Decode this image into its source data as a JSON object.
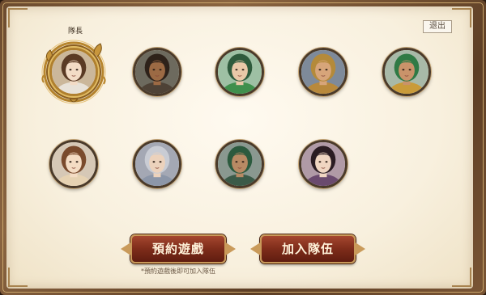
{
  "dialog": {
    "exit_label": "退出",
    "leader_label": "隊長"
  },
  "members": [
    {
      "id": "leader",
      "is_leader": true,
      "portrait": "female-long-brown-hair",
      "palette": {
        "skin": "#f3dcc6",
        "hair": "#5a3a24",
        "bg": "#cbb79a",
        "armor": "#e8e2d8"
      }
    },
    {
      "id": "member-2",
      "is_leader": false,
      "portrait": "bearded-warrior-dark",
      "palette": {
        "skin": "#9c6a44",
        "hair": "#2e221a",
        "bg": "#6d6a5e",
        "armor": "#4e4236"
      }
    },
    {
      "id": "member-3",
      "is_leader": false,
      "portrait": "green-armored-warrior",
      "palette": {
        "skin": "#e9c8a8",
        "hair": "#2e5a3c",
        "bg": "#9ec0a4",
        "armor": "#3f8f4c"
      }
    },
    {
      "id": "member-4",
      "is_leader": false,
      "portrait": "golden-helmet-warrior",
      "palette": {
        "skin": "#d7a57a",
        "hair": "#b48a3a",
        "bg": "#7e8a9a",
        "armor": "#b8893c"
      }
    },
    {
      "id": "member-5",
      "is_leader": false,
      "portrait": "green-cap-bearded-general",
      "palette": {
        "skin": "#c9936a",
        "hair": "#2f7a45",
        "bg": "#a8b9a8",
        "armor": "#c99b3a"
      }
    },
    {
      "id": "member-6",
      "is_leader": false,
      "portrait": "female-with-flower",
      "palette": {
        "skin": "#f4dcc4",
        "hair": "#7a4a2c",
        "bg": "#d6c8b6",
        "armor": "#e6d2b2"
      }
    },
    {
      "id": "member-7",
      "is_leader": false,
      "portrait": "silver-haired-strategist",
      "palette": {
        "skin": "#ecd2bc",
        "hair": "#c9ccd4",
        "bg": "#a4a8b4",
        "armor": "#8c96a8"
      }
    },
    {
      "id": "member-8",
      "is_leader": false,
      "portrait": "green-hat-long-beard-warrior",
      "palette": {
        "skin": "#b88a64",
        "hair": "#2c5a3e",
        "bg": "#8a9890",
        "armor": "#3b5a48"
      }
    },
    {
      "id": "member-9",
      "is_leader": false,
      "portrait": "female-dark-hair-ornaments",
      "palette": {
        "skin": "#f0d6c2",
        "hair": "#2a1c22",
        "bg": "#b09aa6",
        "armor": "#6a4a6e"
      }
    }
  ],
  "actions": {
    "reserve_label": "預約遊戲",
    "join_label": "加入隊伍",
    "hint": "*預約遊戲後即可加入隊伍"
  }
}
